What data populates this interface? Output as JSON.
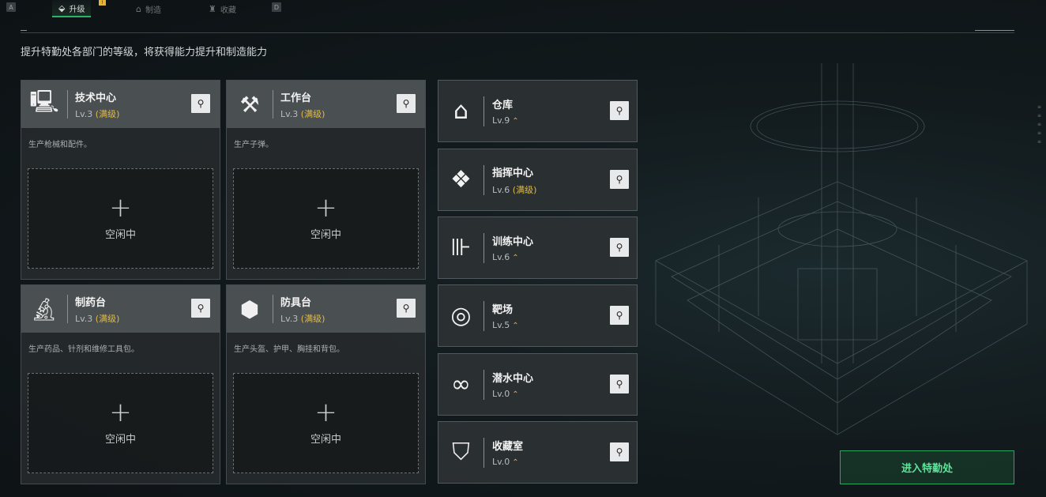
{
  "tabs": {
    "key_left": "A",
    "key_right": "D",
    "items": [
      {
        "label": "升级",
        "icon": "upgrade-icon",
        "active": true
      },
      {
        "label": "制造",
        "icon": "factory-icon",
        "active": false
      },
      {
        "label": "收藏",
        "icon": "trophy-icon",
        "active": false
      }
    ],
    "badge": "!"
  },
  "subtitle": "提升特勤处各部门的等级，将获得能力提升和制造能力",
  "production": [
    {
      "name": "技术中心",
      "level": "Lv.3",
      "max": "(满级)",
      "desc": "生产枪械和配件。",
      "slot_plus": "+",
      "slot_label": "空闲中",
      "icon": "computer-icon"
    },
    {
      "name": "工作台",
      "level": "Lv.3",
      "max": "(满级)",
      "desc": "生产子弹。",
      "slot_plus": "+",
      "slot_label": "空闲中",
      "icon": "tools-icon"
    },
    {
      "name": "制药台",
      "level": "Lv.3",
      "max": "(满级)",
      "desc": "生产药品、针剂和维修工具包。",
      "slot_plus": "+",
      "slot_label": "空闲中",
      "icon": "microscope-icon"
    },
    {
      "name": "防具台",
      "level": "Lv.3",
      "max": "(满级)",
      "desc": "生产头盔、护甲、胸挂和背包。",
      "slot_plus": "+",
      "slot_label": "空闲中",
      "icon": "armor-cubes-icon"
    }
  ],
  "facilities": [
    {
      "name": "仓库",
      "level": "Lv.9",
      "max": "",
      "upgrade": "⌃",
      "icon": "warehouse-icon"
    },
    {
      "name": "指挥中心",
      "level": "Lv.6",
      "max": "(满级)",
      "upgrade": "",
      "icon": "chip-icon"
    },
    {
      "name": "训练中心",
      "level": "Lv.6",
      "max": "",
      "upgrade": "⌃",
      "icon": "dumbbell-icon"
    },
    {
      "name": "靶场",
      "level": "Lv.5",
      "max": "",
      "upgrade": "⌃",
      "icon": "target-icon"
    },
    {
      "name": "潜水中心",
      "level": "Lv.0",
      "max": "",
      "upgrade": "⌃",
      "icon": "diving-mask-icon"
    },
    {
      "name": "收藏室",
      "level": "Lv.0",
      "max": "",
      "upgrade": "⌃",
      "icon": "display-case-icon"
    }
  ],
  "enter_button": "进入特勤处",
  "colors": {
    "accent_green": "#2bb36a",
    "max_gold": "#e1bb45"
  }
}
